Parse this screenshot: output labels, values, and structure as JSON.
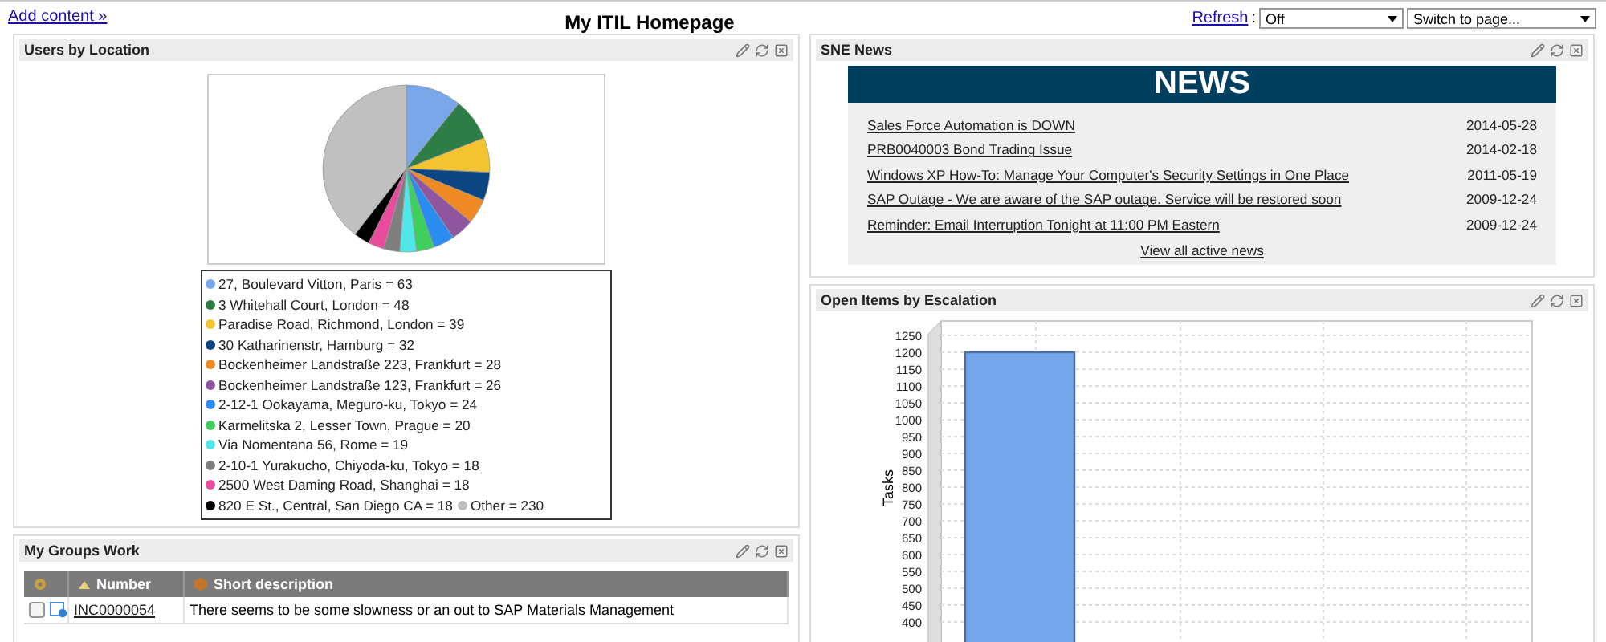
{
  "header": {
    "add_content": "Add content »",
    "title": "My ITIL Homepage",
    "refresh_link": "Refresh",
    "refresh_separator": ":",
    "refresh_select": {
      "value": "Off"
    },
    "page_select": {
      "value": "Switch to page..."
    }
  },
  "users_by_location": {
    "title": "Users by Location",
    "slices": [
      {
        "color": "#79a7e9"
      },
      {
        "color": "#2e7d46"
      },
      {
        "color": "#f4c430"
      },
      {
        "color": "#0b4682"
      },
      {
        "color": "#f08a24"
      },
      {
        "color": "#8f559f"
      },
      {
        "color": "#2b8df1"
      },
      {
        "color": "#3ecf5c"
      },
      {
        "color": "#4fe7e7"
      },
      {
        "color": "#7f7f7f"
      },
      {
        "color": "#e94c9c"
      },
      {
        "color": "#000000"
      },
      {
        "color": "#c0c0c0"
      }
    ],
    "chart_data": {
      "type": "pie",
      "categories": [
        "27, Boulevard Vitton, Paris = 63",
        "3 Whitehall Court, London = 48",
        "Paradise Road, Richmond, London = 39",
        "30 Katharinenstr, Hamburg = 32",
        "Bockenheimer Landstraße 223, Frankfurt = 28",
        "Bockenheimer Landstraße 123, Frankfurt = 26",
        "2-12-1 Ookayama, Meguro-ku, Tokyo = 24",
        "Karmelitska 2, Lesser Town, Prague = 20",
        "Via Nomentana 56, Rome = 19",
        "2-10-1 Yurakucho, Chiyoda-ku, Tokyo = 18",
        "2500 West Daming Road, Shanghai = 18",
        "820 E St., Central, San Diego CA = 18",
        "Other = 230"
      ],
      "values": [
        63,
        48,
        39,
        32,
        28,
        26,
        24,
        20,
        19,
        18,
        18,
        18,
        230
      ]
    }
  },
  "my_groups_work": {
    "title": "My Groups Work",
    "columns": [
      "Number",
      "Short description"
    ],
    "rows": [
      {
        "checked": false,
        "number": "INC0000054",
        "short_description": "There seems to be some slowness or an out to SAP Materials Management"
      }
    ]
  },
  "sne_news": {
    "title": "SNE News",
    "banner": "NEWS",
    "items": [
      {
        "headline": "Sales Force Automation is DOWN",
        "date": "2014-05-28"
      },
      {
        "headline": "PRB0040003 Bond Trading Issue",
        "date": "2014-02-18"
      },
      {
        "headline": "Windows XP How-To: Manage Your Computer's Security Settings in One Place",
        "date": "2011-05-19"
      },
      {
        "headline": "SAP Outage - We are aware of the SAP outage. Service will be restored soon",
        "date": "2009-12-24"
      },
      {
        "headline": "Reminder: Email Interruption Tonight at 11:00 PM Eastern",
        "date": "2009-12-24"
      }
    ],
    "view_all": "View all active news"
  },
  "open_items": {
    "title": "Open Items by Escalation",
    "chart_data": {
      "type": "bar",
      "ylabel": "Tasks",
      "values": [
        1200
      ],
      "ylim": [
        0,
        1250
      ],
      "grid": true,
      "yticks": [
        400,
        450,
        500,
        550,
        600,
        650,
        700,
        750,
        800,
        850,
        900,
        950,
        1000,
        1050,
        1100,
        1150,
        1200,
        1250
      ]
    }
  }
}
